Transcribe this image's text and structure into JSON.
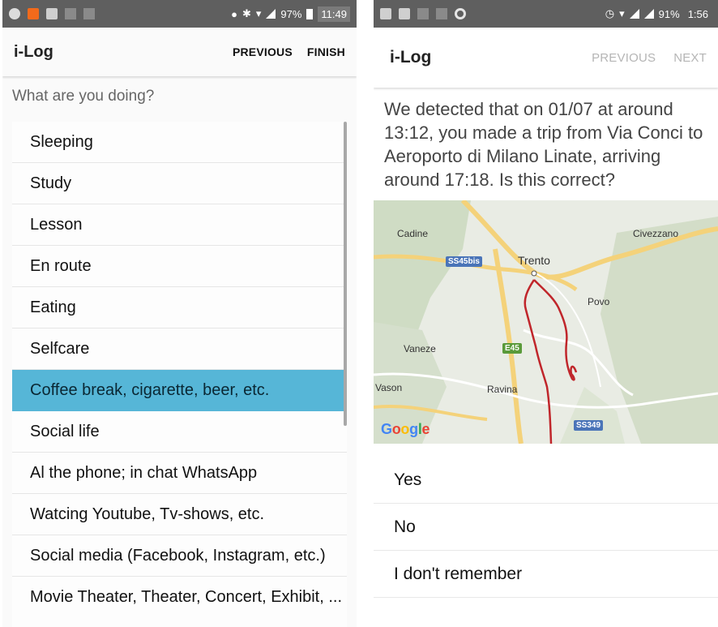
{
  "left_screen": {
    "statusbar": {
      "battery": "97%",
      "time": "11:49"
    },
    "appbar": {
      "title": "i-Log",
      "previous_label": "PREVIOUS",
      "finish_label": "FINISH"
    },
    "prompt": "What are you doing?",
    "activities": [
      "Sleeping",
      "Study",
      "Lesson",
      "En route",
      "Eating",
      "Selfcare",
      "Coffee break, cigarette, beer, etc.",
      "Social life",
      "Al the phone; in chat WhatsApp",
      "Watcing Youtube, Tv-shows, etc.",
      "Social media (Facebook, Instagram, etc.)",
      "Movie Theater, Theater, Concert, Exhibit, ..."
    ],
    "selected_activity": "Coffee break, cigarette, beer, etc.",
    "colors": {
      "selected": "#56b6d7"
    }
  },
  "right_screen": {
    "statusbar": {
      "battery": "91%",
      "time": "1:56"
    },
    "appbar": {
      "title": "i-Log",
      "previous_label": "PREVIOUS",
      "next_label": "NEXT"
    },
    "question": "We detected that on 01/07 at around 13:12, you made a trip from Via Conci to Aeroporto di Milano Linate, arriving around 17:18. Is this correct?",
    "map": {
      "places": [
        "Cadine",
        "Trento",
        "Civezzano",
        "Povo",
        "Vaneze",
        "Vason",
        "Ravina"
      ],
      "shields": [
        "SS45bis",
        "E45",
        "SS349"
      ],
      "logo": "Google",
      "route_color": "#c0262b"
    },
    "answers": [
      "Yes",
      "No",
      "I don't remember"
    ]
  }
}
